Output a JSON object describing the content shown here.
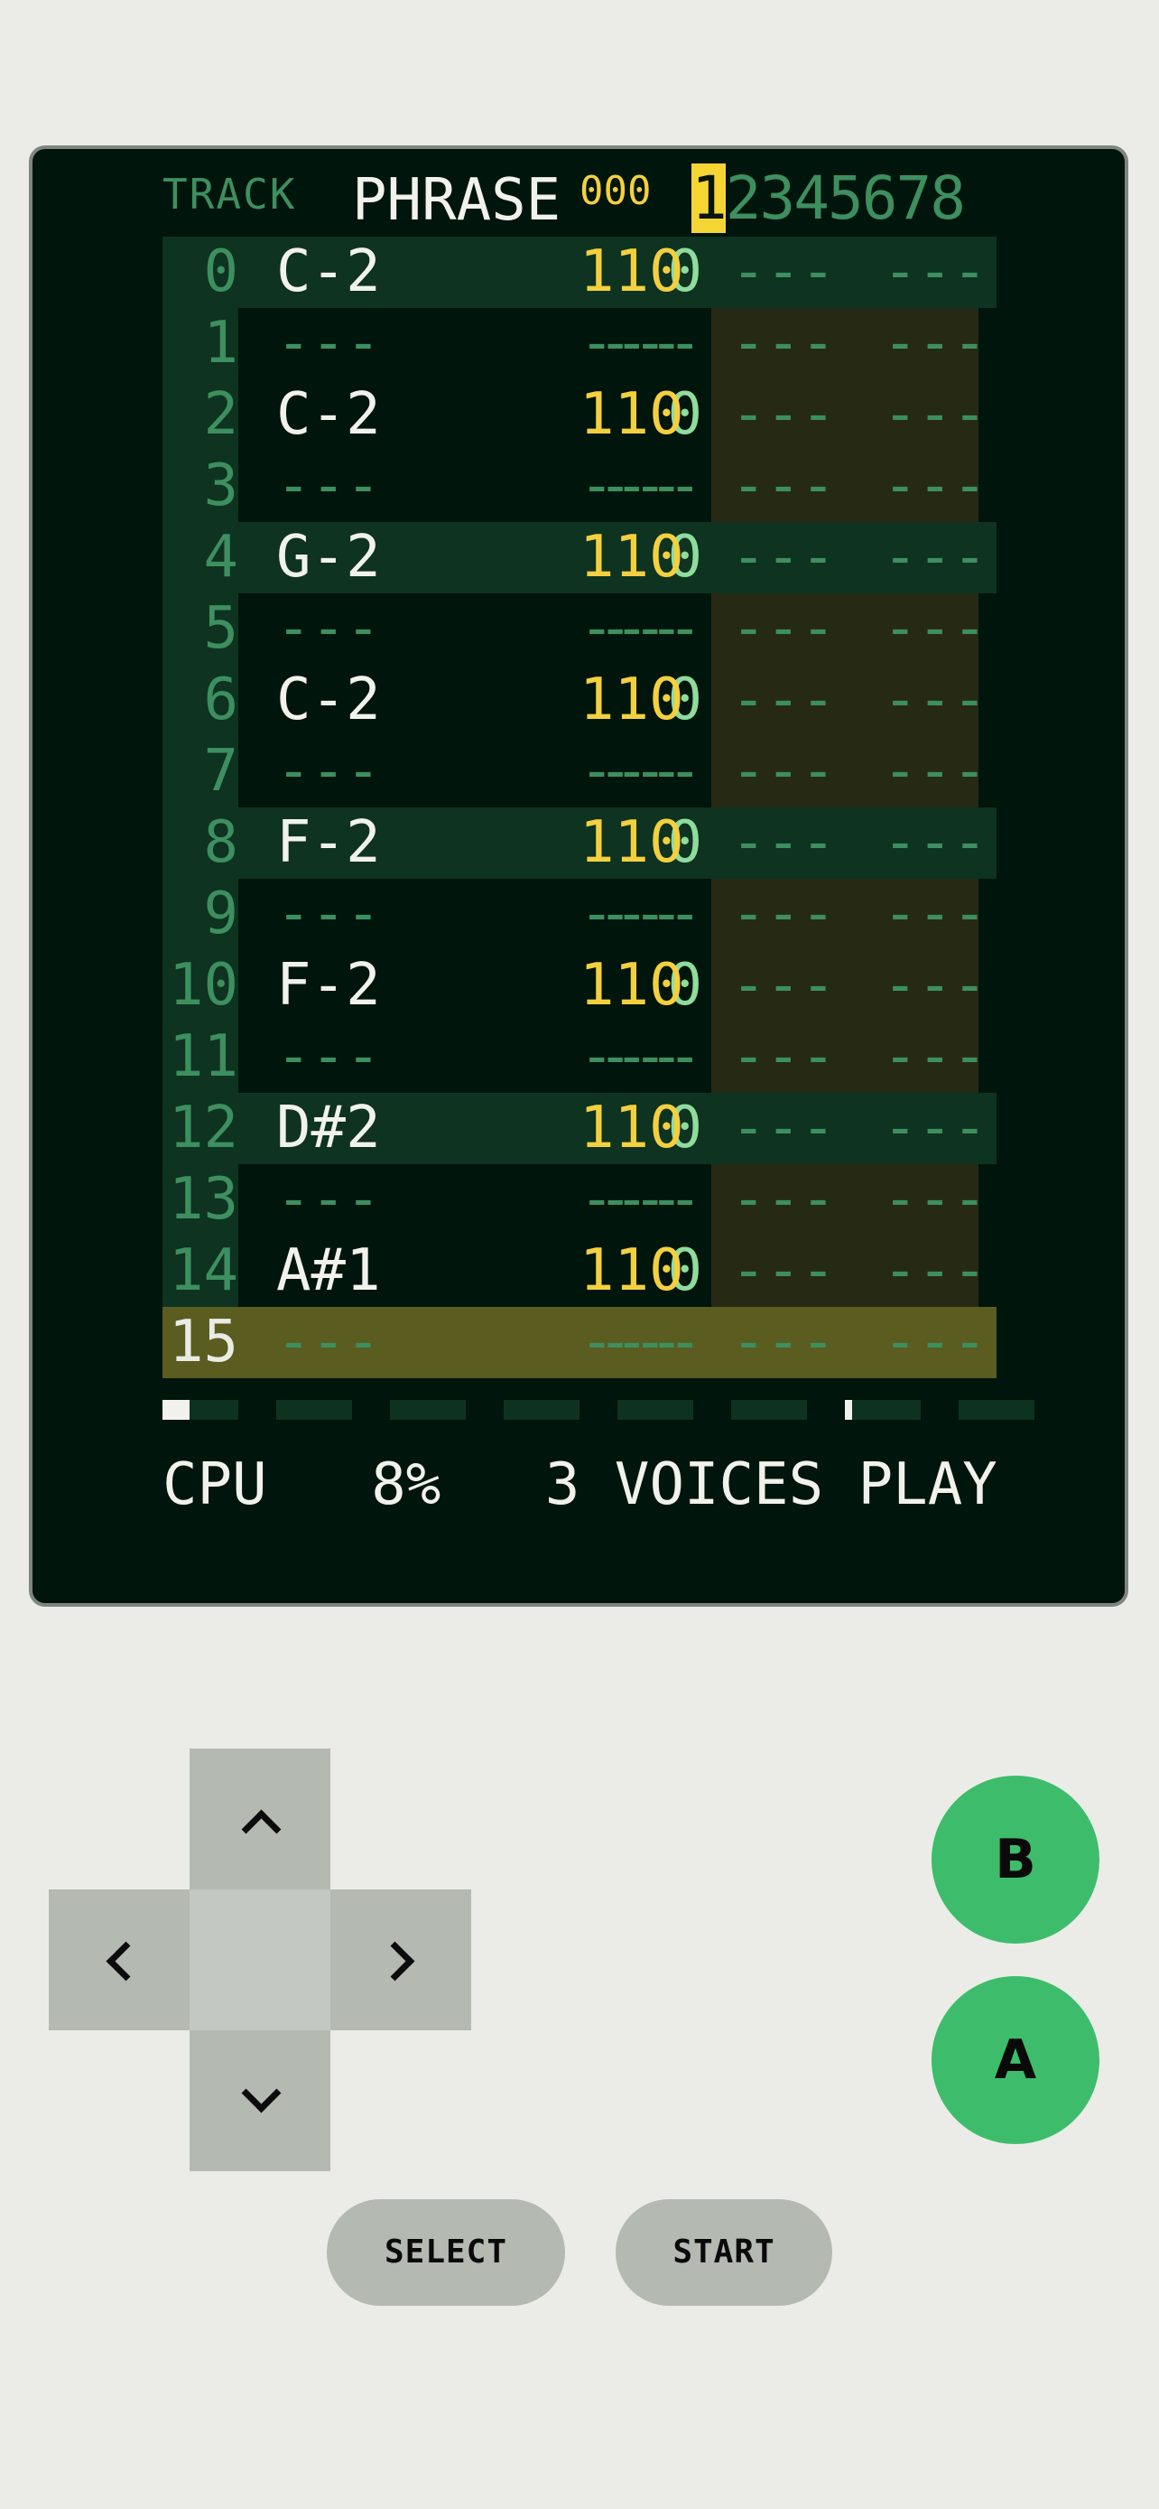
{
  "header": {
    "track_label": "TRACK",
    "phrase_label": "PHRASE",
    "phrase_number": "000",
    "tracks": [
      "1",
      "2",
      "3",
      "4",
      "5",
      "6",
      "7",
      "8"
    ],
    "current_track": "1"
  },
  "rows": [
    {
      "num": "0",
      "note": "C-2",
      "inst": "0",
      "vol": "110",
      "fx1": "---",
      "fx2": "---"
    },
    {
      "num": "1",
      "note": "---",
      "inst": "---",
      "vol": "---",
      "fx1": "---",
      "fx2": "---"
    },
    {
      "num": "2",
      "note": "C-2",
      "inst": "0",
      "vol": "110",
      "fx1": "---",
      "fx2": "---"
    },
    {
      "num": "3",
      "note": "---",
      "inst": "---",
      "vol": "---",
      "fx1": "---",
      "fx2": "---"
    },
    {
      "num": "4",
      "note": "G-2",
      "inst": "0",
      "vol": "110",
      "fx1": "---",
      "fx2": "---"
    },
    {
      "num": "5",
      "note": "---",
      "inst": "---",
      "vol": "---",
      "fx1": "---",
      "fx2": "---"
    },
    {
      "num": "6",
      "note": "C-2",
      "inst": "0",
      "vol": "110",
      "fx1": "---",
      "fx2": "---"
    },
    {
      "num": "7",
      "note": "---",
      "inst": "---",
      "vol": "---",
      "fx1": "---",
      "fx2": "---"
    },
    {
      "num": "8",
      "note": "F-2",
      "inst": "0",
      "vol": "110",
      "fx1": "---",
      "fx2": "---"
    },
    {
      "num": "9",
      "note": "---",
      "inst": "---",
      "vol": "---",
      "fx1": "---",
      "fx2": "---"
    },
    {
      "num": "10",
      "note": "F-2",
      "inst": "0",
      "vol": "110",
      "fx1": "---",
      "fx2": "---"
    },
    {
      "num": "11",
      "note": "---",
      "inst": "---",
      "vol": "---",
      "fx1": "---",
      "fx2": "---"
    },
    {
      "num": "12",
      "note": "D#2",
      "inst": "0",
      "vol": "110",
      "fx1": "---",
      "fx2": "---"
    },
    {
      "num": "13",
      "note": "---",
      "inst": "---",
      "vol": "---",
      "fx1": "---",
      "fx2": "---"
    },
    {
      "num": "14",
      "note": "A#1",
      "inst": "0",
      "vol": "110",
      "fx1": "---",
      "fx2": "---"
    },
    {
      "num": "15",
      "note": "---",
      "inst": "---",
      "vol": "---",
      "fx1": "---",
      "fx2": "---"
    }
  ],
  "playing_row": 15,
  "status": {
    "cpu_label": "CPU",
    "cpu_value": "8%",
    "voices_count": "3",
    "voices_label": "VOICES",
    "mode": "PLAY"
  },
  "controls": {
    "b_label": "B",
    "a_label": "A",
    "select_label": "SELECT",
    "start_label": "START"
  },
  "colors": {
    "screen_bg": "#00150c",
    "accent_yellow": "#f4d03f",
    "dim_green": "#3d8f5f",
    "button_green": "#3dbd6b"
  }
}
